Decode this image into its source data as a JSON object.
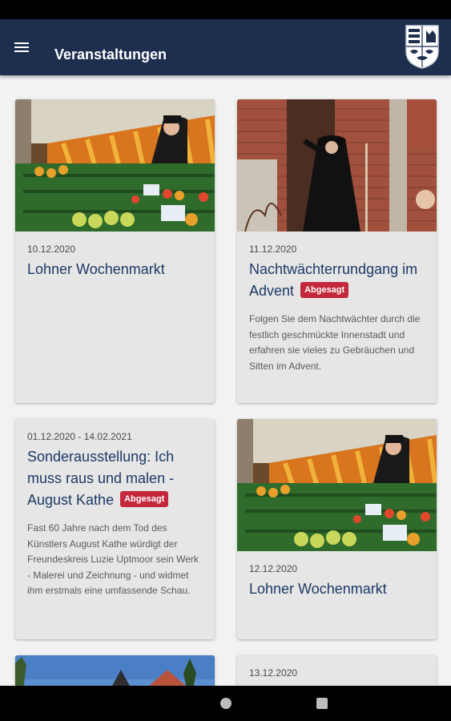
{
  "app_bar": {
    "title": "Veranstaltungen",
    "menu_icon": "menu-icon",
    "logo": "coat-of-arms-logo"
  },
  "colors": {
    "app_bar": "#1d2e4f",
    "title": "#1d3a66",
    "badge": "#c4283b",
    "card_bg": "#e6e6e6"
  },
  "events": [
    {
      "date": "10.12.2020",
      "title": "Lohner Wochenmarkt",
      "badge": "",
      "description": "",
      "image": "market-photo"
    },
    {
      "date": "11.12.2020",
      "title": "Nachtwächterrundgang im Advent",
      "badge": "Abgesagt",
      "description": "Folgen Sie dem Nachtwächter durch die festlich geschmückte Innenstadt und erfahren sie vieles zu Gebräuchen und Sitten im Advent.",
      "image": "night-watchman-photo"
    },
    {
      "date": "01.12.2020 - 14.02.2021",
      "title": "Sonderausstellung: Ich muss raus und malen - August Kathe",
      "badge": "Abgesagt",
      "description": "Fast 60 Jahre nach dem Tod des Künstlers August Kathe würdigt der Freundeskreis Luzie Uptmoor sein Werk - Malerei und Zeichnung - und widmet ihm erstmals eine umfassende Schau.",
      "image": ""
    },
    {
      "date": "12.12.2020",
      "title": "Lohner Wochenmarkt",
      "badge": "",
      "description": "",
      "image": "market-photo"
    },
    {
      "date": "",
      "title": "",
      "badge": "",
      "description": "",
      "image": "church-photo"
    },
    {
      "date": "13.12.2020",
      "title": "",
      "badge": "",
      "description": "",
      "image": ""
    }
  ],
  "nav": {
    "home_icon": "home-icon",
    "recents_icon": "recents-icon"
  }
}
